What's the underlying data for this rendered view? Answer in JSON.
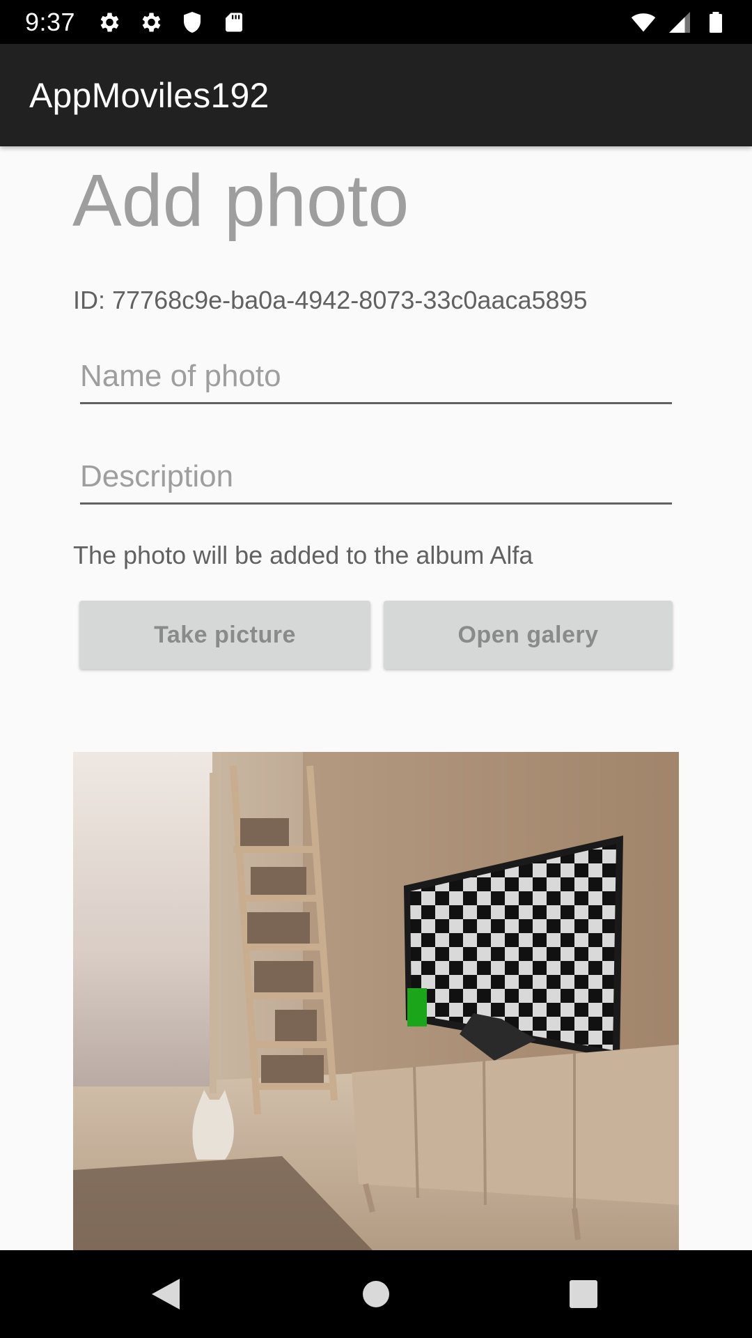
{
  "status_bar": {
    "time": "9:37",
    "left_icons": [
      "settings-icon",
      "settings-icon",
      "shield-icon",
      "sd-card-icon"
    ],
    "right_icons": [
      "wifi-icon",
      "signal-icon",
      "battery-icon"
    ]
  },
  "app_bar": {
    "title": "AppMoviles192"
  },
  "form": {
    "heading": "Add photo",
    "id_label": "ID: 77768c9e-ba0a-4942-8073-33c0aaca5895",
    "name_field": {
      "value": "",
      "placeholder": "Name of photo"
    },
    "description_field": {
      "value": "",
      "placeholder": "Description"
    },
    "album_note": "The photo will be added to the album Alfa",
    "take_picture_label": "Take picture",
    "open_gallery_label": "Open galery"
  },
  "preview": {
    "content": "living-room photo with cat, bookshelf and TV showing checkerboard"
  },
  "nav_bar": {
    "buttons": [
      "back-icon",
      "home-icon",
      "recents-icon"
    ]
  },
  "colors": {
    "status_bar": "#000000",
    "app_bar": "#212121",
    "background": "#fafafa",
    "button": "#d6d7d7",
    "tv_marker": "#1aa51a"
  }
}
